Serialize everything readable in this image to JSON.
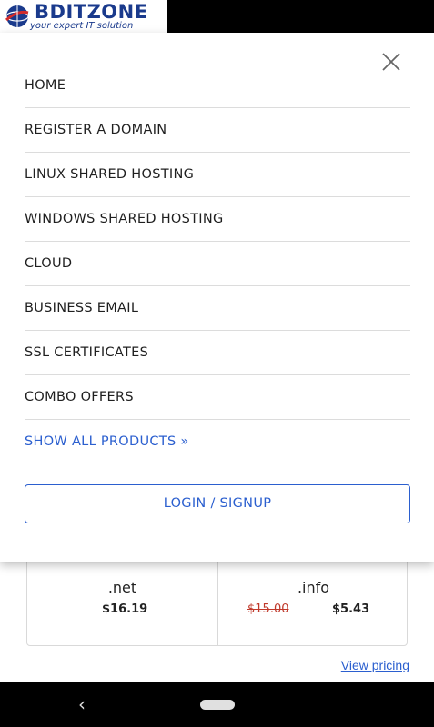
{
  "logo": {
    "name": "BDITZONE",
    "tagline": "your expert IT solution"
  },
  "menu": {
    "items": [
      {
        "label": "HOME"
      },
      {
        "label": "REGISTER A DOMAIN"
      },
      {
        "label": "LINUX SHARED HOSTING"
      },
      {
        "label": "WINDOWS SHARED HOSTING"
      },
      {
        "label": "CLOUD"
      },
      {
        "label": "BUSINESS EMAIL"
      },
      {
        "label": "SSL CERTIFICATES"
      },
      {
        "label": "COMBO OFFERS"
      },
      {
        "label": "SHOW ALL PRODUCTS »"
      }
    ],
    "login_label": "LOGIN / SIGNUP"
  },
  "tlds": [
    {
      "name": ".net",
      "price": "$16.19",
      "old_price": ""
    },
    {
      "name": ".info",
      "price": "$5.43",
      "old_price": "$15.00"
    }
  ],
  "view_pricing": "View pricing",
  "colors": {
    "accent": "#2b5fcf",
    "logo_blue": "#1a3a8c",
    "strike_red": "#c0392b"
  },
  "icons": {
    "close": "close-icon",
    "back": "back-icon",
    "home": "home-pill-icon",
    "globe": "globe-icon"
  }
}
